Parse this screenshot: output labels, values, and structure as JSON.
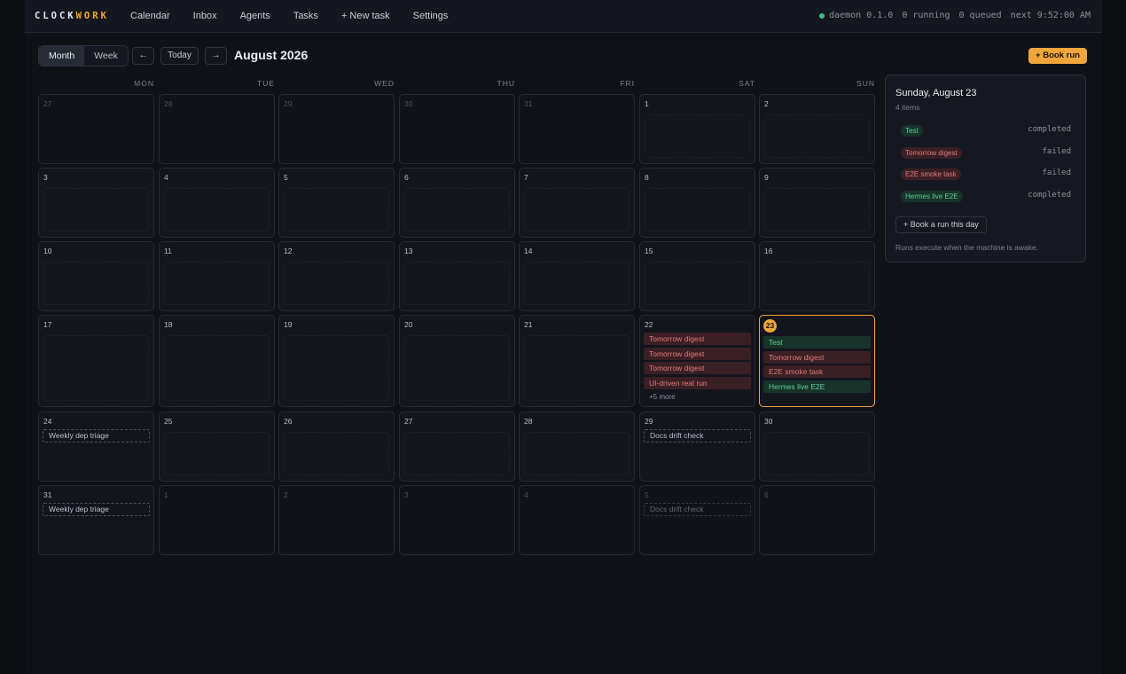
{
  "brand": {
    "part1": "CLOCK",
    "part2": "WORK"
  },
  "nav": [
    "Calendar",
    "Inbox",
    "Agents",
    "Tasks",
    "+ New task",
    "Settings"
  ],
  "status": {
    "daemon": "daemon 0.1.0",
    "running": "0 running",
    "queued": "0 queued",
    "next": "next 9:52:00 AM",
    "dot_color": "#3fbf7f"
  },
  "toolbar": {
    "view_month": "Month",
    "view_week": "Week",
    "active_view": "Month",
    "prev": "←",
    "today": "Today",
    "next": "→",
    "title": "August 2026",
    "book_run": "+ Book run"
  },
  "weekdays": [
    "MON",
    "TUE",
    "WED",
    "THU",
    "FRI",
    "SAT",
    "SUN"
  ],
  "calendar": {
    "weeks": [
      [
        {
          "d": "27",
          "out": true
        },
        {
          "d": "28",
          "out": true
        },
        {
          "d": "29",
          "out": true
        },
        {
          "d": "30",
          "out": true
        },
        {
          "d": "31",
          "out": true
        },
        {
          "d": "1"
        },
        {
          "d": "2"
        }
      ],
      [
        {
          "d": "3"
        },
        {
          "d": "4"
        },
        {
          "d": "5"
        },
        {
          "d": "6"
        },
        {
          "d": "7"
        },
        {
          "d": "8"
        },
        {
          "d": "9"
        }
      ],
      [
        {
          "d": "10"
        },
        {
          "d": "11"
        },
        {
          "d": "12"
        },
        {
          "d": "13"
        },
        {
          "d": "14"
        },
        {
          "d": "15"
        },
        {
          "d": "16"
        }
      ],
      [
        {
          "d": "17"
        },
        {
          "d": "18"
        },
        {
          "d": "19"
        },
        {
          "d": "20"
        },
        {
          "d": "21"
        },
        {
          "d": "22",
          "events": [
            {
              "t": "Tomorrow digest",
              "s": "failed"
            },
            {
              "t": "Tomorrow digest",
              "s": "failed"
            },
            {
              "t": "Tomorrow digest",
              "s": "failed"
            },
            {
              "t": "UI-driven real run",
              "s": "failed"
            }
          ],
          "more": "+5 more"
        },
        {
          "d": "23",
          "today": true,
          "events": [
            {
              "t": "Test",
              "s": "completed"
            },
            {
              "t": "Tomorrow digest",
              "s": "failed"
            },
            {
              "t": "E2E smoke task",
              "s": "failed"
            },
            {
              "t": "Hermes live E2E",
              "s": "completed"
            }
          ]
        }
      ],
      [
        {
          "d": "24",
          "events": [
            {
              "t": "Weekly dep triage",
              "s": "sched"
            }
          ]
        },
        {
          "d": "25"
        },
        {
          "d": "26"
        },
        {
          "d": "27"
        },
        {
          "d": "28"
        },
        {
          "d": "29",
          "events": [
            {
              "t": "Docs drift check",
              "s": "sched"
            }
          ]
        },
        {
          "d": "30"
        }
      ],
      [
        {
          "d": "31",
          "events": [
            {
              "t": "Weekly dep triage",
              "s": "sched"
            }
          ]
        },
        {
          "d": "1",
          "out": true
        },
        {
          "d": "2",
          "out": true
        },
        {
          "d": "3",
          "out": true
        },
        {
          "d": "4",
          "out": true
        },
        {
          "d": "5",
          "out": true,
          "events": [
            {
              "t": "Docs drift check",
              "s": "sched"
            }
          ]
        },
        {
          "d": "6",
          "out": true
        }
      ]
    ]
  },
  "panel": {
    "title": "Sunday, August 23",
    "subtitle": "4 items",
    "items": [
      {
        "label": "Test",
        "status": "completed"
      },
      {
        "label": "Tomorrow digest",
        "status": "failed"
      },
      {
        "label": "E2E smoke task",
        "status": "failed"
      },
      {
        "label": "Hermes live E2E",
        "status": "completed"
      }
    ],
    "book_button": "+ Book a run this day",
    "note": "Runs execute when the machine is awake."
  },
  "colors": {
    "accent": "#f0a63a",
    "failed": "#e07a7a",
    "completed": "#5fcf95"
  }
}
